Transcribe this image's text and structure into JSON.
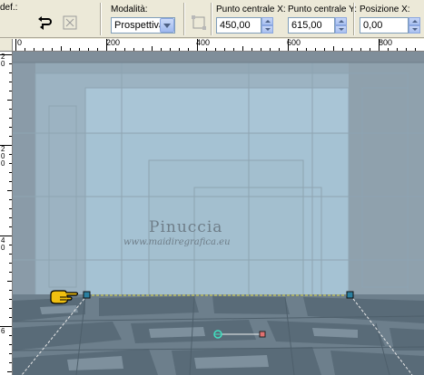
{
  "toolbar": {
    "preset_label": "def.:",
    "mode": {
      "label": "Modalità:",
      "value": "Prospettiva"
    },
    "center_x": {
      "label": "Punto centrale X:",
      "value": "450,00"
    },
    "center_y": {
      "label": "Punto centrale Y:",
      "value": "615,00"
    },
    "position_x": {
      "label": "Posizione X:",
      "value": "0,00"
    }
  },
  "ruler": {
    "h_labels": [
      "0",
      "200",
      "400",
      "600",
      "800"
    ],
    "v_labels": [
      "2 0",
      "2 0 0",
      "4 0",
      "6"
    ]
  },
  "watermark": {
    "title": "Pinuccia",
    "url": "www.maidiregrafica.eu"
  },
  "colors": {
    "panel": "#ece9d8",
    "sky": "#a8c4d4",
    "stone": "#6d7f8c",
    "pointer": "#f0c010"
  },
  "icons": [
    "rotate-icon",
    "reset-icon",
    "grid-icon",
    "pointer-hand-icon"
  ]
}
